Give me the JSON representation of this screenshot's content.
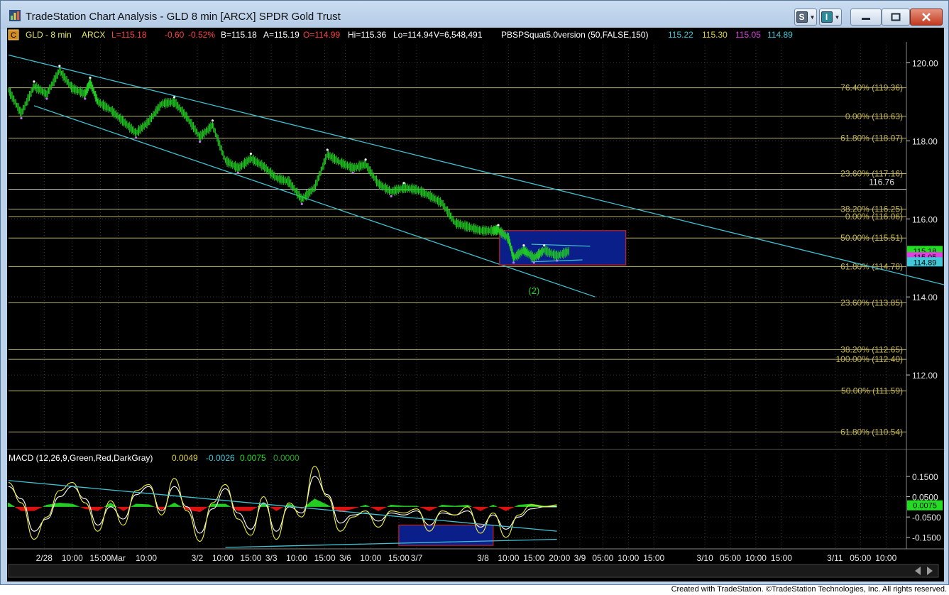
{
  "window": {
    "title": "TradeStation Chart Analysis - GLD 8 min [ARCX] SPDR Gold Trust",
    "button_s": "S",
    "button_i": "I"
  },
  "footer": "Created with TradeStation. ©TradeStation Technologies, Inc. All rights reserved.",
  "colors": {
    "background": "#000000",
    "price_bars": "#22cc22",
    "channel_lines": "#40c0d0",
    "fib_lines": "#b8b070",
    "fib_text": "#c8b850",
    "box_fill": "#0a1f8a",
    "box_border": "#c82020",
    "macd_line": "#f0f040",
    "signal_line": "#40c0d0",
    "hist_pos": "#22cc22",
    "hist_neg": "#dd1111"
  },
  "chart_data": [
    {
      "type": "candlestick",
      "header": {
        "badge": "C",
        "symbol": "GLD - 8 min",
        "exchange": "ARCX",
        "last": "L=115.18",
        "change": "-0.60",
        "change_pct": "-0.52%",
        "bid": "B=115.18",
        "ask": "A=115.19",
        "open": "O=114.99",
        "high": "Hi=115.36",
        "low": "Lo=114.94",
        "volume": "V=6,548,491",
        "study": "PBSPSquat5.0version (50,FALSE,150)",
        "study_values": [
          {
            "text": "115.22",
            "color": "#40c8d8"
          },
          {
            "text": "115.30",
            "color": "#e0d040"
          },
          {
            "text": "115.05",
            "color": "#e040e0"
          },
          {
            "text": "114.89",
            "color": "#40c8d8"
          }
        ]
      },
      "ylim": [
        110.2,
        120.5
      ],
      "y_ticks": [
        "120.00",
        "118.00",
        "116.00",
        "114.00",
        "112.00"
      ],
      "y_tick_values": [
        120,
        118,
        116,
        114,
        112
      ],
      "price_markers": [
        {
          "text": "115.18",
          "value": 115.18,
          "color": "#22dd22"
        },
        {
          "text": "115.05",
          "value": 115.02,
          "color": "#e040e0"
        },
        {
          "text": "114.89",
          "value": 114.89,
          "color": "#40c8d8"
        }
      ],
      "price_path": [
        [
          0.0,
          119.3
        ],
        [
          0.5,
          118.7
        ],
        [
          1.0,
          119.4
        ],
        [
          1.5,
          119.2
        ],
        [
          2.0,
          119.8
        ],
        [
          2.5,
          119.35
        ],
        [
          3.0,
          119.2
        ],
        [
          3.2,
          119.5
        ],
        [
          3.5,
          119.0
        ],
        [
          4.0,
          118.8
        ],
        [
          4.5,
          118.5
        ],
        [
          5.0,
          118.2
        ],
        [
          5.5,
          118.5
        ],
        [
          6.0,
          118.95
        ],
        [
          6.5,
          119.0
        ],
        [
          7.0,
          118.6
        ],
        [
          7.5,
          118.1
        ],
        [
          8.0,
          118.4
        ],
        [
          8.5,
          117.5
        ],
        [
          9.0,
          117.3
        ],
        [
          9.5,
          117.55
        ],
        [
          10.0,
          117.35
        ],
        [
          10.5,
          117.05
        ],
        [
          11.0,
          116.95
        ],
        [
          11.5,
          116.5
        ],
        [
          12.0,
          116.8
        ],
        [
          12.5,
          117.65
        ],
        [
          13.0,
          117.45
        ],
        [
          13.5,
          117.3
        ],
        [
          14.0,
          117.4
        ],
        [
          14.5,
          116.9
        ],
        [
          15.0,
          116.7
        ],
        [
          15.5,
          116.8
        ],
        [
          16.0,
          116.75
        ],
        [
          16.5,
          116.6
        ],
        [
          17.0,
          116.4
        ],
        [
          17.5,
          115.9
        ],
        [
          18.0,
          115.8
        ],
        [
          18.5,
          115.7
        ],
        [
          19.0,
          115.7
        ],
        [
          19.2,
          115.72
        ],
        [
          19.6,
          115.5
        ],
        [
          19.8,
          115.0
        ],
        [
          20.2,
          115.2
        ],
        [
          20.6,
          115.0
        ],
        [
          21.0,
          115.2
        ],
        [
          21.5,
          115.05
        ],
        [
          22.0,
          115.18
        ]
      ],
      "fib_levels": [
        {
          "label": "76.40% (119.36)",
          "value": 119.36
        },
        {
          "label": "0.00% (118.63)",
          "value": 118.63
        },
        {
          "label": "61.80% (118.07)",
          "value": 118.07
        },
        {
          "label": "23.60% (117.16)",
          "value": 117.16
        },
        {
          "label": "38.20% (116.25)",
          "value": 116.25
        },
        {
          "label": "0.00% (116.06)",
          "value": 116.06
        },
        {
          "label": "50.00% (115.51)",
          "value": 115.51
        },
        {
          "label": "61.80% (114.78)",
          "value": 114.78
        },
        {
          "label": "23.60% (113.85)",
          "value": 113.85
        },
        {
          "label": "38.20% (112.65)",
          "value": 112.65
        },
        {
          "label": "100.00% (112.40)",
          "value": 112.4
        },
        {
          "label": "50.00% (111.59)",
          "value": 111.59
        },
        {
          "label": "61.80% (110.54)",
          "value": 110.54
        }
      ],
      "horizontal_lines": [
        {
          "label": "116.76",
          "value": 116.76
        }
      ],
      "wave_label": "(2)",
      "wave_label_at": [
        20.6,
        114.0
      ],
      "channel_upper": [
        [
          0.0,
          120.2
        ],
        [
          38.0,
          114.1
        ]
      ],
      "channel_lower": [
        [
          1.0,
          118.9
        ],
        [
          23.0,
          114.0
        ]
      ],
      "box": {
        "x0": 19.25,
        "x1": 24.2,
        "y0": 115.7,
        "y1": 114.82
      },
      "triangle": {
        "top": [
          [
            20.5,
            115.35
          ],
          [
            22.8,
            115.3
          ]
        ],
        "bottom": [
          [
            20.5,
            114.9
          ],
          [
            22.5,
            114.95
          ]
        ]
      },
      "x_ticks": [
        {
          "label": "2/28",
          "x": 1.4
        },
        {
          "label": "10:00",
          "x": 2.5
        },
        {
          "label": "15:00",
          "x": 3.6
        },
        {
          "label": "Mar",
          "x": 4.3
        },
        {
          "label": "10:00",
          "x": 5.4
        },
        {
          "label": "3/2",
          "x": 7.4
        },
        {
          "label": "10:00",
          "x": 8.4
        },
        {
          "label": "15:00",
          "x": 9.5
        },
        {
          "label": "3/3",
          "x": 10.3
        },
        {
          "label": "10:00",
          "x": 11.3
        },
        {
          "label": "15:00",
          "x": 12.4
        },
        {
          "label": "3/6",
          "x": 13.2
        },
        {
          "label": "10:00",
          "x": 14.2
        },
        {
          "label": "15:00",
          "x": 15.3
        },
        {
          "label": "3/7",
          "x": 16.0
        },
        {
          "label": "3/8",
          "x": 18.6
        },
        {
          "label": "10:00",
          "x": 19.6
        },
        {
          "label": "15:00",
          "x": 20.6
        },
        {
          "label": "20:00",
          "x": 21.6
        },
        {
          "label": "3/9",
          "x": 22.4
        },
        {
          "label": "05:00",
          "x": 23.3
        },
        {
          "label": "10:00",
          "x": 24.3
        },
        {
          "label": "15:00",
          "x": 25.3
        },
        {
          "label": "3/10",
          "x": 27.3
        },
        {
          "label": "05:00",
          "x": 28.3
        },
        {
          "label": "10:00",
          "x": 29.3
        },
        {
          "label": "15:00",
          "x": 30.3
        },
        {
          "label": "3/11",
          "x": 32.4
        },
        {
          "label": "05:00",
          "x": 33.4
        },
        {
          "label": "10:00",
          "x": 34.4
        }
      ],
      "xlim": [
        0,
        35.2
      ],
      "grid": true
    },
    {
      "type": "macd",
      "title": "MACD (12,26,9,Green,Red,DarkGray)",
      "values": [
        {
          "text": "0.0049",
          "color": "#e0d040"
        },
        {
          "text": "-0.0026",
          "color": "#40c8d8"
        },
        {
          "text": "0.0075",
          "color": "#22dd22"
        },
        {
          "text": "0.0000",
          "color": "#22aa22"
        }
      ],
      "ylim": [
        -0.2,
        0.22
      ],
      "y_ticks": [
        "0.1500",
        "0.0500",
        "-0.0500",
        "-0.1500"
      ],
      "y_tick_values": [
        0.15,
        0.05,
        -0.05,
        -0.15
      ],
      "last_marker": {
        "text": "0.0075",
        "value": 0.0075
      },
      "macd_series": [
        [
          0.0,
          0.12
        ],
        [
          0.5,
          0.02
        ],
        [
          1.0,
          -0.16
        ],
        [
          1.5,
          -0.05
        ],
        [
          2.0,
          0.08
        ],
        [
          2.5,
          0.12
        ],
        [
          3.0,
          0.02
        ],
        [
          3.5,
          -0.12
        ],
        [
          4.0,
          0.03
        ],
        [
          4.5,
          -0.09
        ],
        [
          5.0,
          0.08
        ],
        [
          5.5,
          0.11
        ],
        [
          6.0,
          -0.04
        ],
        [
          6.5,
          0.14
        ],
        [
          7.0,
          -0.02
        ],
        [
          7.5,
          -0.17
        ],
        [
          8.0,
          0.02
        ],
        [
          8.5,
          0.11
        ],
        [
          9.0,
          -0.06
        ],
        [
          9.5,
          -0.14
        ],
        [
          10.0,
          0.05
        ],
        [
          10.5,
          -0.16
        ],
        [
          11.0,
          0.02
        ],
        [
          11.5,
          -0.05
        ],
        [
          12.0,
          0.2
        ],
        [
          12.5,
          0.05
        ],
        [
          13.0,
          -0.12
        ],
        [
          13.5,
          -0.05
        ],
        [
          14.0,
          -0.02
        ],
        [
          14.5,
          -0.1
        ],
        [
          15.0,
          -0.02
        ],
        [
          15.5,
          -0.03
        ],
        [
          16.0,
          -0.01
        ],
        [
          16.5,
          -0.12
        ],
        [
          17.0,
          -0.02
        ],
        [
          17.5,
          -0.04
        ],
        [
          18.0,
          0.0
        ],
        [
          18.5,
          -0.13
        ],
        [
          19.0,
          -0.03
        ],
        [
          19.5,
          -0.15
        ],
        [
          20.0,
          -0.04
        ],
        [
          20.5,
          0.01
        ],
        [
          21.0,
          0.0
        ],
        [
          21.5,
          0.01
        ]
      ],
      "signal_series": [
        [
          0.0,
          0.1
        ],
        [
          0.5,
          0.04
        ],
        [
          1.0,
          -0.12
        ],
        [
          1.5,
          -0.06
        ],
        [
          2.0,
          0.05
        ],
        [
          2.5,
          0.1
        ],
        [
          3.0,
          0.04
        ],
        [
          3.5,
          -0.09
        ],
        [
          4.0,
          0.0
        ],
        [
          4.5,
          -0.06
        ],
        [
          5.0,
          0.06
        ],
        [
          5.5,
          0.1
        ],
        [
          6.0,
          -0.02
        ],
        [
          6.5,
          0.1
        ],
        [
          7.0,
          0.0
        ],
        [
          7.5,
          -0.13
        ],
        [
          8.0,
          -0.01
        ],
        [
          8.5,
          0.09
        ],
        [
          9.0,
          -0.03
        ],
        [
          9.5,
          -0.11
        ],
        [
          10.0,
          0.02
        ],
        [
          10.5,
          -0.12
        ],
        [
          11.0,
          0.0
        ],
        [
          11.5,
          -0.03
        ],
        [
          12.0,
          0.15
        ],
        [
          12.5,
          0.06
        ],
        [
          13.0,
          -0.08
        ],
        [
          13.5,
          -0.04
        ],
        [
          14.0,
          -0.03
        ],
        [
          14.5,
          -0.07
        ],
        [
          15.0,
          -0.03
        ],
        [
          15.5,
          -0.04
        ],
        [
          16.0,
          -0.02
        ],
        [
          16.5,
          -0.09
        ],
        [
          17.0,
          -0.03
        ],
        [
          17.5,
          -0.04
        ],
        [
          18.0,
          -0.02
        ],
        [
          18.5,
          -0.1
        ],
        [
          19.0,
          -0.04
        ],
        [
          19.5,
          -0.11
        ],
        [
          20.0,
          -0.05
        ],
        [
          20.5,
          -0.01
        ],
        [
          21.0,
          0.0
        ],
        [
          21.5,
          0.0
        ]
      ],
      "histogram": [
        [
          0.0,
          0.02
        ],
        [
          0.5,
          -0.02
        ],
        [
          1.0,
          -0.02
        ],
        [
          1.5,
          0.01
        ],
        [
          2.0,
          0.02
        ],
        [
          2.5,
          0.015
        ],
        [
          3.0,
          -0.01
        ],
        [
          3.5,
          -0.02
        ],
        [
          4.0,
          0.02
        ],
        [
          4.5,
          -0.02
        ],
        [
          5.0,
          0.015
        ],
        [
          5.5,
          0.012
        ],
        [
          6.0,
          -0.015
        ],
        [
          6.5,
          0.02
        ],
        [
          7.0,
          -0.015
        ],
        [
          7.5,
          -0.025
        ],
        [
          8.0,
          0.015
        ],
        [
          8.5,
          0.015
        ],
        [
          9.0,
          -0.02
        ],
        [
          9.5,
          -0.02
        ],
        [
          10.0,
          0.02
        ],
        [
          10.5,
          -0.02
        ],
        [
          11.0,
          0.015
        ],
        [
          11.5,
          -0.01
        ],
        [
          12.0,
          0.04
        ],
        [
          12.5,
          0.01
        ],
        [
          13.0,
          -0.025
        ],
        [
          13.5,
          -0.01
        ],
        [
          14.0,
          0.01
        ],
        [
          14.5,
          -0.02
        ],
        [
          15.0,
          0.01
        ],
        [
          15.5,
          0.005
        ],
        [
          16.0,
          0.005
        ],
        [
          16.5,
          -0.02
        ],
        [
          17.0,
          0.01
        ],
        [
          17.5,
          0.005
        ],
        [
          18.0,
          0.01
        ],
        [
          18.5,
          -0.02
        ],
        [
          19.0,
          0.01
        ],
        [
          19.5,
          -0.02
        ],
        [
          20.0,
          0.01
        ],
        [
          20.5,
          0.015
        ],
        [
          21.0,
          0.005
        ],
        [
          21.5,
          0.0075
        ]
      ],
      "trendline_upper": [
        [
          0.0,
          0.13
        ],
        [
          21.5,
          -0.12
        ]
      ],
      "trendline_lower": [
        [
          8.5,
          -0.2
        ],
        [
          21.5,
          -0.16
        ]
      ],
      "box": {
        "x0": 15.3,
        "x1": 19.0,
        "y0": -0.09,
        "y1": -0.19
      }
    }
  ]
}
